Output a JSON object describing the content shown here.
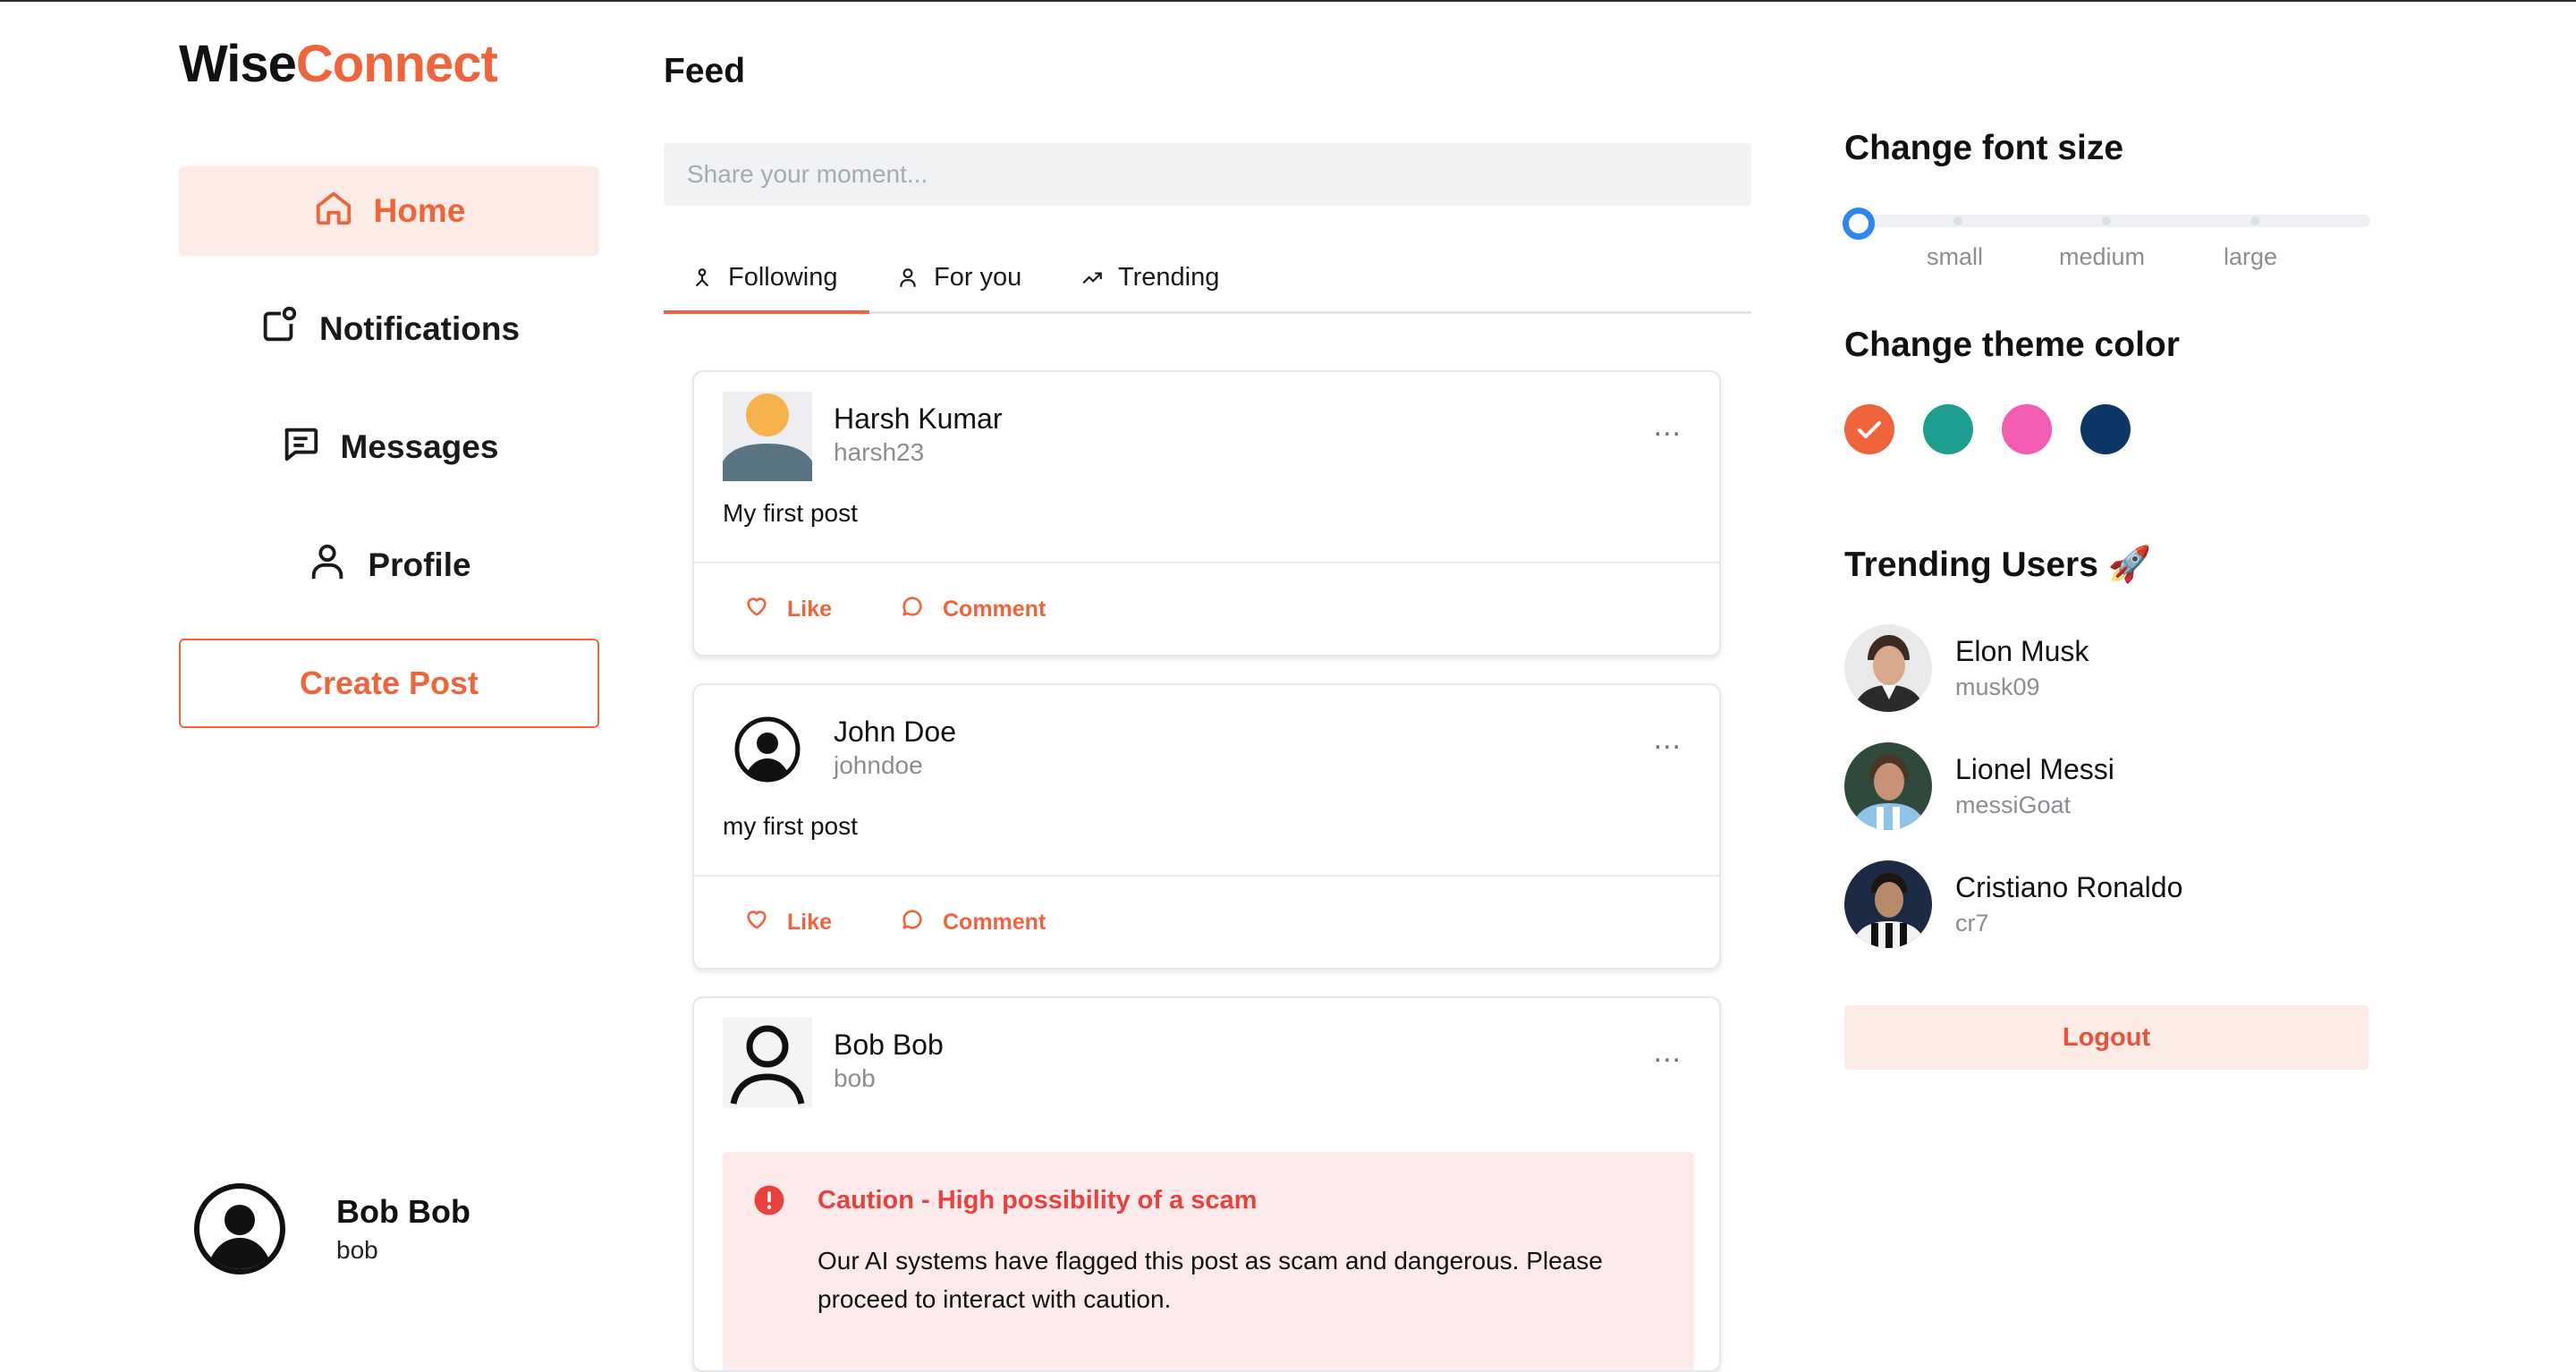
{
  "brand": {
    "part1": "Wise",
    "part2": "Connect",
    "accent": "#f0643c"
  },
  "sidebar": {
    "items": [
      {
        "label": "Home",
        "icon": "home-icon",
        "active": true
      },
      {
        "label": "Notifications",
        "icon": "notification-icon",
        "active": false
      },
      {
        "label": "Messages",
        "icon": "message-icon",
        "active": false
      },
      {
        "label": "Profile",
        "icon": "user-icon",
        "active": false
      }
    ],
    "create_post": "Create Post",
    "current_user": {
      "name": "Bob Bob",
      "username": "bob"
    }
  },
  "feed": {
    "title": "Feed",
    "share_placeholder": "Share your moment...",
    "tabs": [
      {
        "label": "Following",
        "icon": "people-icon",
        "active": true
      },
      {
        "label": "For you",
        "icon": "user-icon",
        "active": false
      },
      {
        "label": "Trending",
        "icon": "trending-icon",
        "active": false
      }
    ],
    "actions": {
      "like": "Like",
      "comment": "Comment"
    },
    "posts": [
      {
        "name": "Harsh Kumar",
        "username": "harsh23",
        "text": "My first post",
        "more": "..."
      },
      {
        "name": "John Doe",
        "username": "johndoe",
        "text": "my first post",
        "more": "..."
      },
      {
        "name": "Bob Bob",
        "username": "bob",
        "more": "...",
        "warning": {
          "title": "Caution - High possibility of a scam",
          "message": "Our AI systems have flagged this post as scam and dangerous. Please proceed to interact with caution."
        }
      }
    ]
  },
  "settings": {
    "font_size": {
      "title": "Change font size",
      "options": [
        "small",
        "medium",
        "large"
      ],
      "selected_index": 0
    },
    "theme": {
      "title": "Change theme color",
      "colors": [
        "#f0643c",
        "#1e9e8f",
        "#f25cb3",
        "#0d3566"
      ],
      "selected": "#f0643c"
    }
  },
  "trending": {
    "title": "Trending Users 🚀",
    "users": [
      {
        "name": "Elon Musk",
        "username": "musk09"
      },
      {
        "name": "Lionel Messi",
        "username": "messiGoat"
      },
      {
        "name": "Cristiano Ronaldo",
        "username": "cr7"
      }
    ]
  },
  "logout": "Logout"
}
